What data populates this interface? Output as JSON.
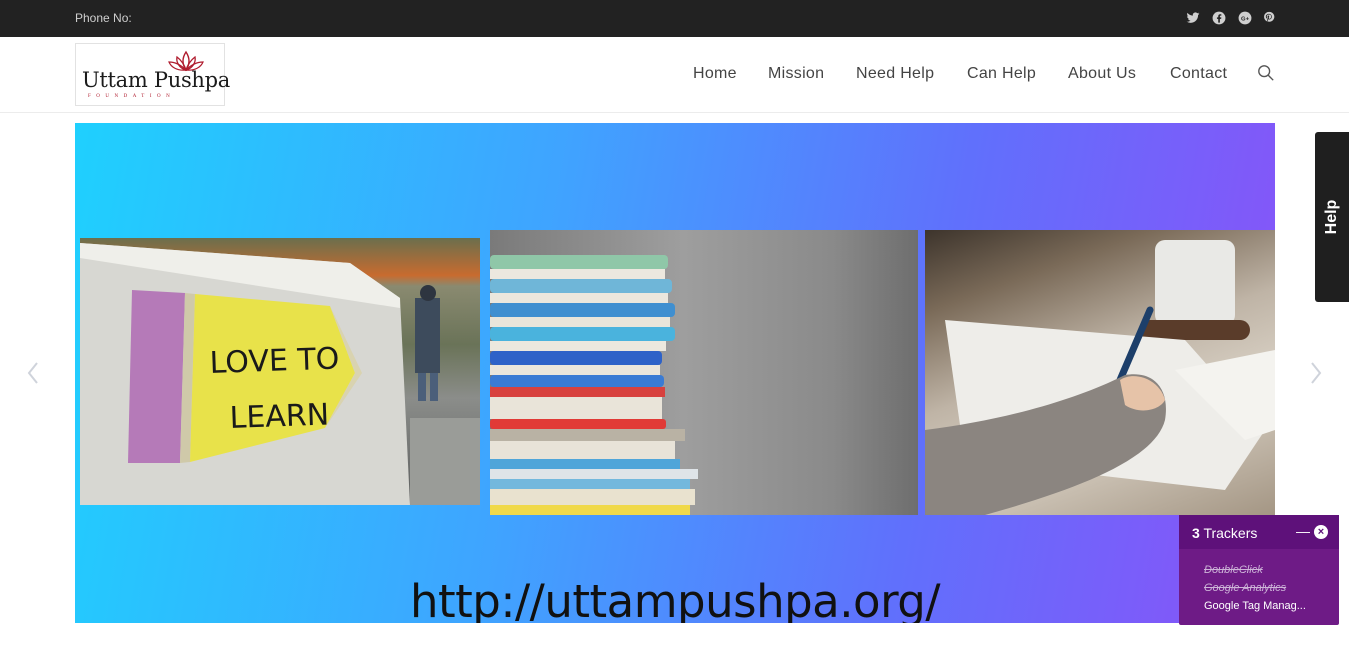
{
  "topbar": {
    "phone_label": "Phone No:",
    "social_icons": [
      "twitter-icon",
      "facebook-icon",
      "google-plus-icon",
      "pinterest-icon"
    ]
  },
  "header": {
    "logo_text": "Uttam Pushpa",
    "logo_subtext": "FOUNDATION",
    "nav": [
      "Home",
      "Mission",
      "Need Help",
      "Can Help",
      "About Us",
      "Contact"
    ],
    "search_icon": "search-icon"
  },
  "slider": {
    "url_text": "http://uttampushpa.org/",
    "photo1_text_line1": "LOVE TO",
    "photo1_text_line2": "LEARN",
    "prev_icon": "chevron-left-icon",
    "next_icon": "chevron-right-icon"
  },
  "help_tab": {
    "label": "Help"
  },
  "tracker_widget": {
    "count": "3",
    "title_suffix": "Trackers",
    "items": [
      "DoubleClick",
      "Google Analytics",
      "Google Tag Manag..."
    ]
  },
  "colors": {
    "topbar_bg": "#222222",
    "tracker_bg": "#6e1b86",
    "slide_gradient_start": "#1fd0fe",
    "slide_gradient_end": "#8a52f8"
  }
}
